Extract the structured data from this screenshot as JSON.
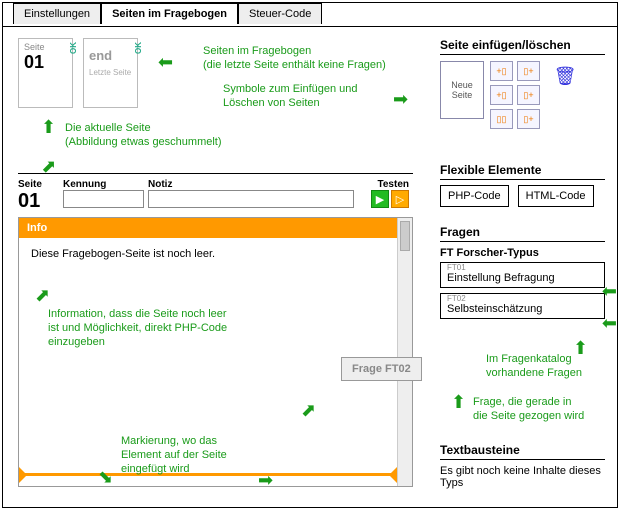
{
  "tabs": {
    "t0": "Einstellungen",
    "t1": "Seiten im Fragebogen",
    "t2": "Steuer-Code"
  },
  "thumbs": {
    "page": {
      "title": "Seite",
      "num": "01",
      "ok": "OK"
    },
    "end": {
      "title": "end",
      "sub": "Letzte Seite",
      "ok": "OK"
    }
  },
  "ann": {
    "pages": "Seiten im Fragebogen\n(die letzte Seite enthält keine Fragen)",
    "symbols": "Symbole zum Einfügen und\nLöschen von Seiten",
    "current": "Die aktuelle Seite\n(Abbildung etwas geschummelt)",
    "info": "Information, dass die Seite noch leer\nist und Möglichkeit, direkt PHP-Code\neinzugeben",
    "insert": "Markierung, wo das\nElement auf der Seite\neingefügt wird",
    "catalog": "Im Fragenkatalog\nvorhandene Fragen",
    "dragging": "Frage, die gerade in\ndie Seite gezogen wird"
  },
  "side": {
    "insert_title": "Seite einfügen/löschen",
    "new_page": "Neue\nSeite",
    "flex_title": "Flexible Elemente",
    "flex_php": "PHP-Code",
    "flex_html": "HTML-Code",
    "fragen_title": "Fragen",
    "ft_group": "FT Forscher-Typus",
    "q1_code": "FT01",
    "q1_label": "Einstellung Befragung",
    "q2_code": "FT02",
    "q2_label": "Selbsteinschätzung",
    "text_title": "Textbausteine",
    "text_empty": "Es gibt noch keine Inhalte dieses Typs"
  },
  "editor": {
    "col_seite": "Seite",
    "num": "01",
    "col_kennung": "Kennung",
    "col_notiz": "Notiz",
    "col_testen": "Testen"
  },
  "content": {
    "bar": "Info",
    "empty": "Diese Fragebogen-Seite ist noch leer."
  },
  "dragged": "Frage FT02"
}
